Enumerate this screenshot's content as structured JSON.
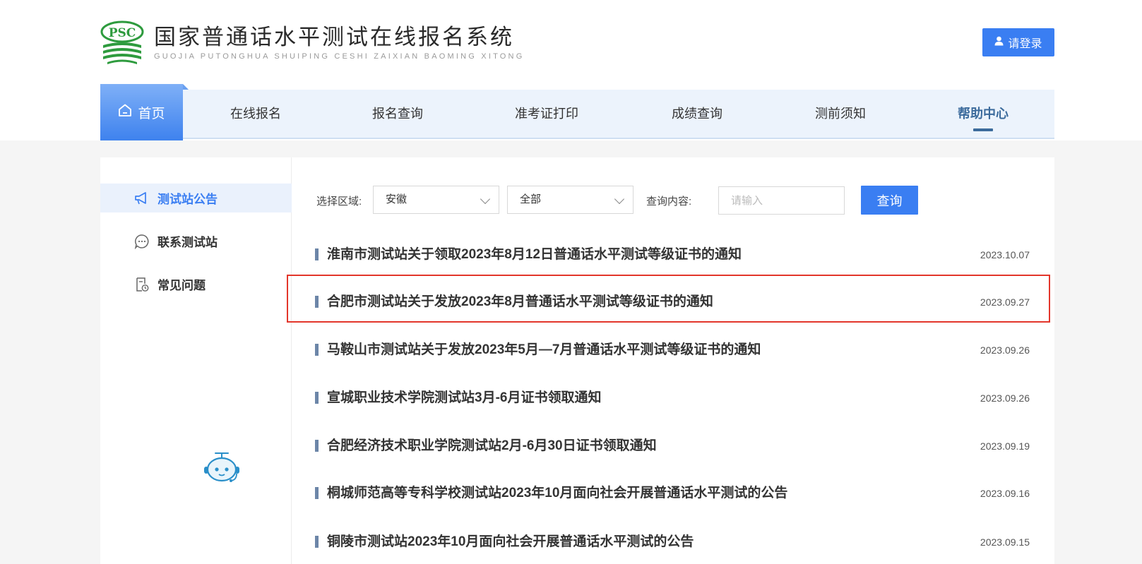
{
  "header": {
    "logo_abbr": "PSC",
    "site_title": "国家普通话水平测试在线报名系统",
    "site_subtitle": "GUOJIA PUTONGHUA SHUIPING CESHI ZAIXIAN BAOMING XITONG",
    "login_label": "请登录"
  },
  "nav": {
    "home": "首页",
    "items": [
      "在线报名",
      "报名查询",
      "准考证打印",
      "成绩查询",
      "测前须知",
      "帮助中心"
    ],
    "active": "帮助中心"
  },
  "sidebar": {
    "items": [
      {
        "label": "测试站公告",
        "icon": "megaphone-icon",
        "active": true
      },
      {
        "label": "联系测试站",
        "icon": "chat-bubble-icon",
        "active": false
      },
      {
        "label": "常见问题",
        "icon": "faq-document-icon",
        "active": false
      }
    ],
    "assistant_icon": "robot-assistant-icon"
  },
  "filters": {
    "region_label": "选择区域:",
    "region_value": "安徽",
    "scope_value": "全部",
    "query_label": "查询内容:",
    "query_placeholder": "请输入",
    "search_label": "查询"
  },
  "notices": [
    {
      "title": "淮南市测试站关于领取2023年8月12日普通话水平测试等级证书的通知",
      "date": "2023.10.07"
    },
    {
      "title": "合肥市测试站关于发放2023年8月普通话水平测试等级证书的通知",
      "date": "2023.09.27"
    },
    {
      "title": "马鞍山市测试站关于发放2023年5月—7月普通话水平测试等级证书的通知",
      "date": "2023.09.26"
    },
    {
      "title": "宣城职业技术学院测试站3月-6月证书领取通知",
      "date": "2023.09.26"
    },
    {
      "title": "合肥经济技术职业学院测试站2月-6月30日证书领取通知",
      "date": "2023.09.19"
    },
    {
      "title": "桐城师范高等专科学校测试站2023年10月面向社会开展普通话水平测试的公告",
      "date": "2023.09.16"
    },
    {
      "title": "铜陵市测试站2023年10月面向社会开展普通话水平测试的公告",
      "date": "2023.09.15"
    }
  ],
  "colors": {
    "accent": "#3a7ef2",
    "nav_bg": "#ecf3fc",
    "active_nav": "#3c6b9c",
    "highlight": "#e3362b",
    "logo_green": "#2e9b3e"
  }
}
